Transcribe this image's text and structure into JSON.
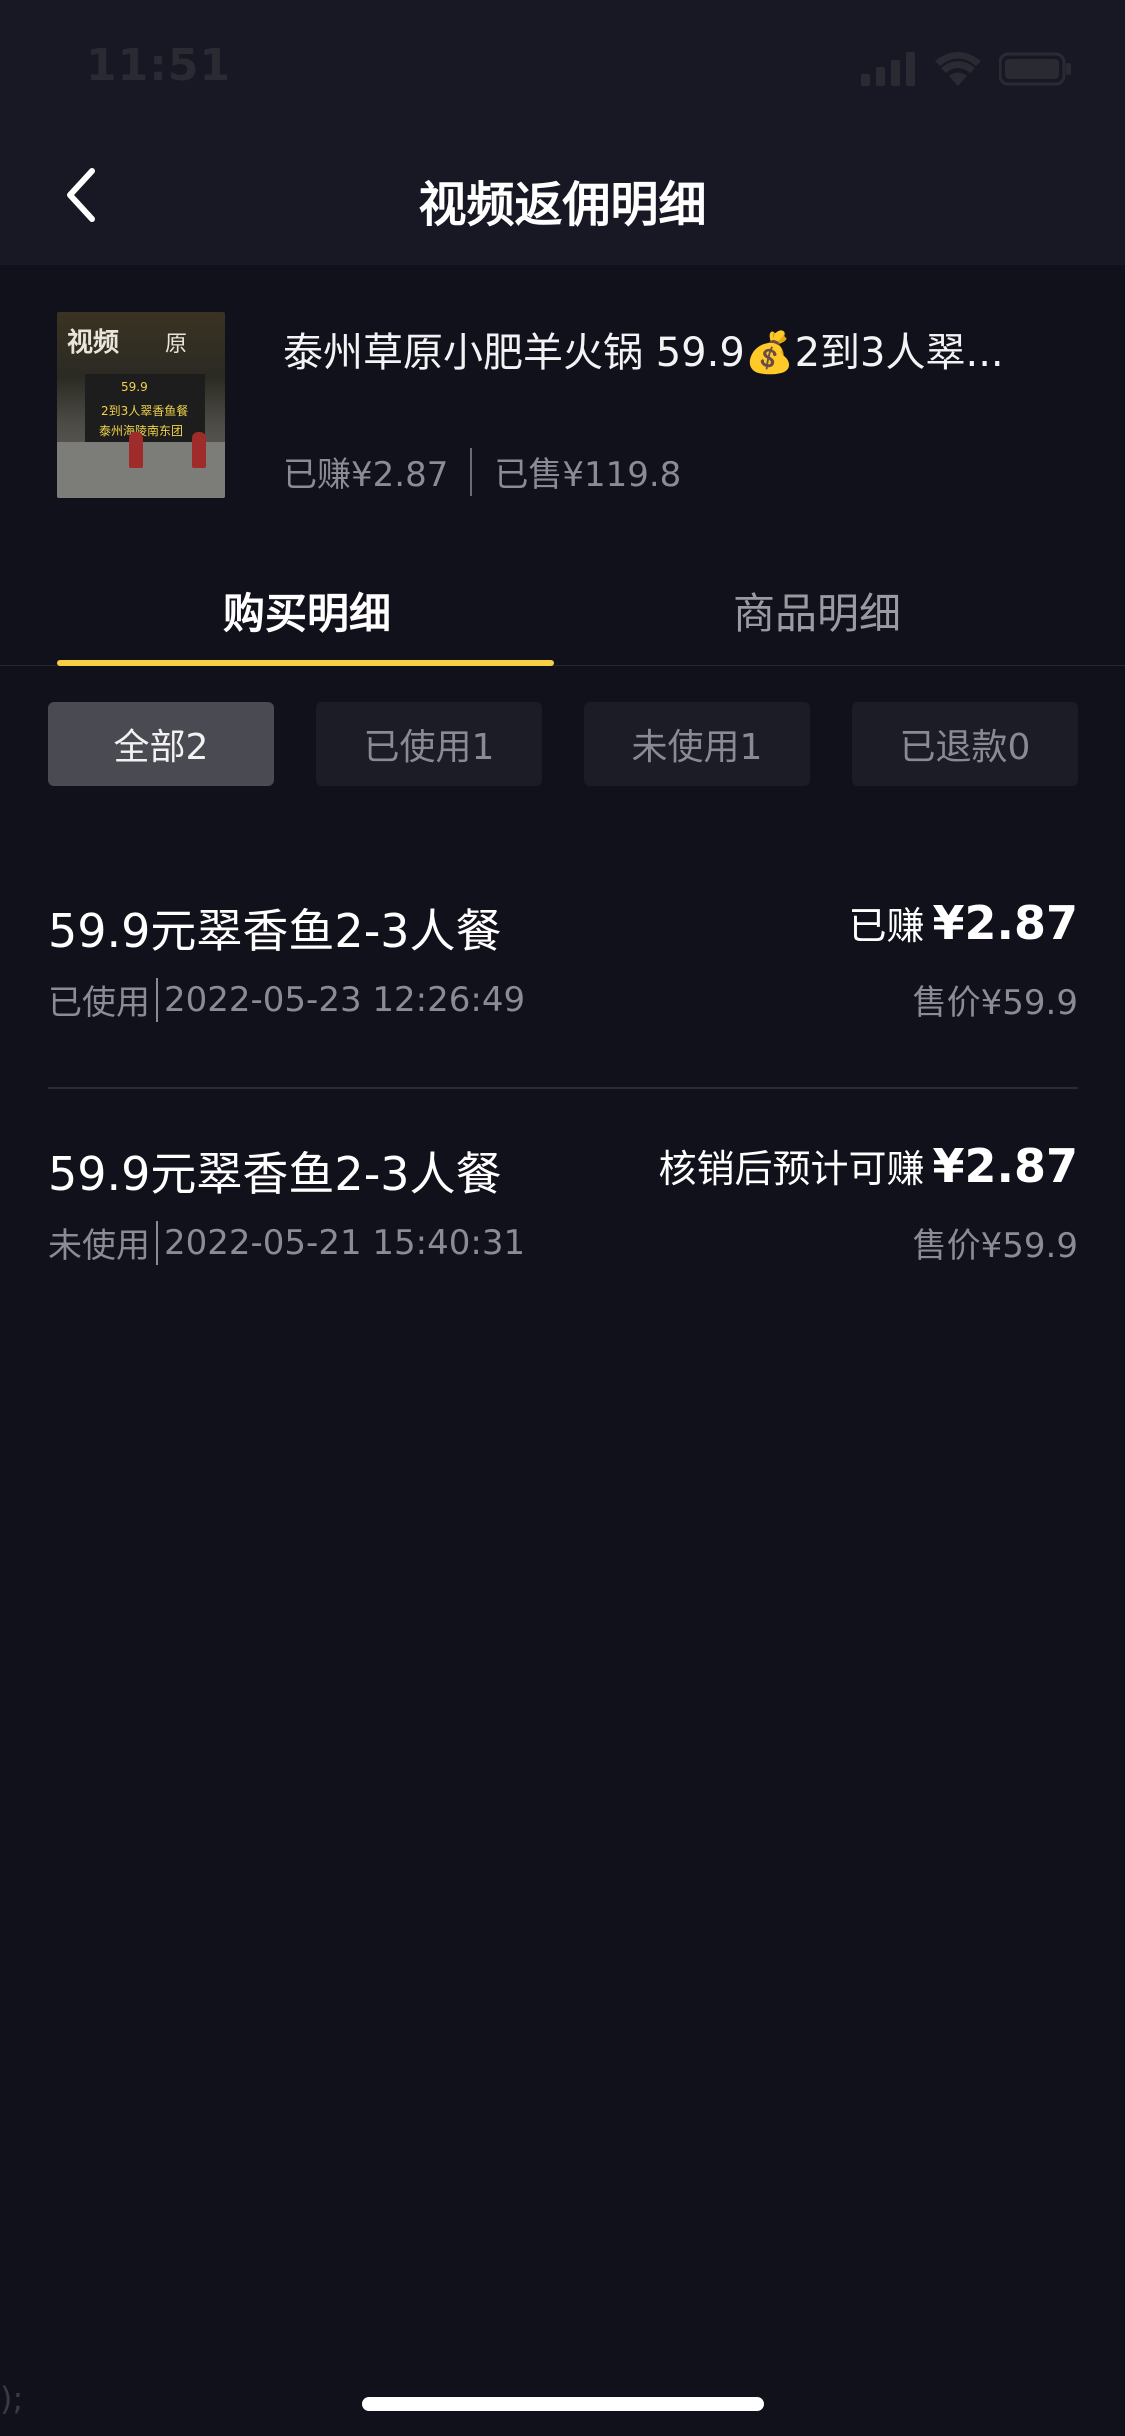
{
  "status": {
    "time": "11:51"
  },
  "header": {
    "title": "视频返佣明细"
  },
  "product": {
    "title": "泰州草原小肥羊火锅 59.9💰2到3人翠...",
    "earned": "已赚¥2.87",
    "sold": "已售¥119.8",
    "thumb_text_1": "视频",
    "thumb_text_2": "原",
    "thumb_sign_1": "59.9",
    "thumb_sign_2": "2到3人翠香鱼餐",
    "thumb_sign_3": "泰州海陵南东团"
  },
  "tabs": [
    {
      "label": "购买明细",
      "active": true
    },
    {
      "label": "商品明细",
      "active": false
    }
  ],
  "filters": [
    {
      "label": "全部2",
      "active": true
    },
    {
      "label": "已使用1",
      "active": false
    },
    {
      "label": "未使用1",
      "active": false
    },
    {
      "label": "已退款0",
      "active": false
    }
  ],
  "orders": [
    {
      "name": "59.9元翠香鱼2-3人餐",
      "status": "已使用",
      "datetime": "2022-05-23 12:26:49",
      "earn_label": "已赚",
      "earn_value": "¥2.87",
      "price": "售价¥59.9"
    },
    {
      "name": "59.9元翠香鱼2-3人餐",
      "status": "未使用",
      "datetime": "2022-05-21 15:40:31",
      "earn_label": "核销后预计可赚",
      "earn_value": "¥2.87",
      "price": "售价¥59.9"
    }
  ],
  "misc": {
    "edge_char": ");"
  },
  "colors": {
    "background": "#11111b",
    "header": "#181824",
    "accent": "#f7cf43"
  },
  "icons": [
    "back-chevron-icon",
    "signal-icon",
    "wifi-icon",
    "battery-icon"
  ]
}
